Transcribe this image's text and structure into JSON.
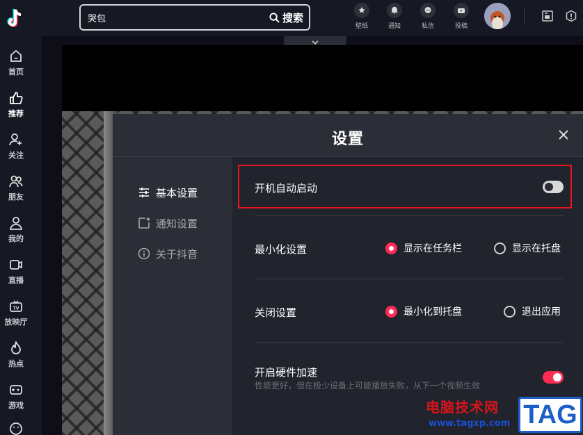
{
  "sidebar": {
    "items": [
      {
        "label": "首页",
        "icon": "home-icon"
      },
      {
        "label": "推荐",
        "icon": "thumbs-up-icon"
      },
      {
        "label": "关注",
        "icon": "follow-icon"
      },
      {
        "label": "朋友",
        "icon": "friends-icon"
      },
      {
        "label": "我的",
        "icon": "user-icon"
      },
      {
        "label": "直播",
        "icon": "live-icon"
      },
      {
        "label": "放映厅",
        "icon": "tv-icon"
      },
      {
        "label": "热点",
        "icon": "flame-icon"
      },
      {
        "label": "游戏",
        "icon": "gamepad-icon"
      }
    ],
    "active_index": 1
  },
  "search": {
    "value": "哭包",
    "button_label": "搜索"
  },
  "topbar": {
    "items": [
      {
        "label": "壁纸",
        "icon": "wallpaper-icon"
      },
      {
        "label": "通知",
        "icon": "bell-icon"
      },
      {
        "label": "私信",
        "icon": "message-icon"
      },
      {
        "label": "投稿",
        "icon": "upload-icon"
      }
    ]
  },
  "settings": {
    "title": "设置",
    "menu": [
      {
        "label": "基本设置",
        "icon": "sliders-icon",
        "active": true
      },
      {
        "label": "通知设置",
        "icon": "notification-settings-icon",
        "active": false
      },
      {
        "label": "关于抖音",
        "icon": "info-icon",
        "active": false
      }
    ],
    "autostart": {
      "label": "开机自动启动",
      "enabled": false
    },
    "minimize": {
      "label": "最小化设置",
      "options": [
        "显示在任务栏",
        "显示在托盘"
      ],
      "selected": 0
    },
    "close": {
      "label": "关闭设置",
      "options": [
        "最小化到托盘",
        "退出应用"
      ],
      "selected": 0
    },
    "hardware": {
      "label": "开启硬件加速",
      "description": "性能更好，但在极少设备上可能播放失败，从下一个视频生效",
      "enabled": true
    }
  },
  "watermark": {
    "title": "电脑技术网",
    "url": "www.tagxp.com",
    "tag": "TAG"
  },
  "colors": {
    "accent": "#fe2c55",
    "highlight_border": "#e8161b",
    "sidebar_bg": "#161823",
    "modal_bg": "#2c2e37",
    "modal_content_bg": "#21232d"
  }
}
